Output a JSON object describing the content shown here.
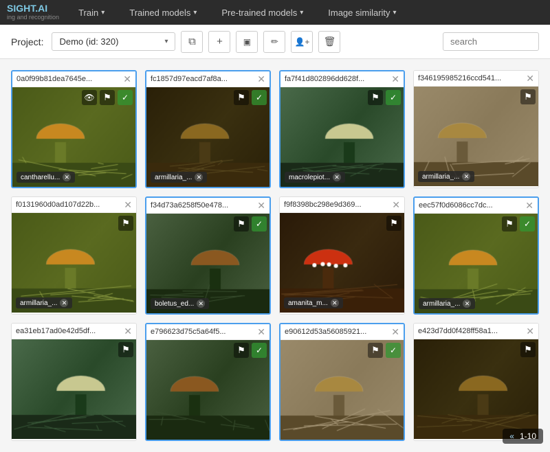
{
  "logo": {
    "name": "SIGHT.AI",
    "sub": "ing and recognition"
  },
  "nav": {
    "items": [
      {
        "label": "Train",
        "id": "train",
        "has_caret": true
      },
      {
        "label": "Trained models",
        "id": "trained-models",
        "has_caret": true
      },
      {
        "label": "Pre-trained models",
        "id": "pretrained-models",
        "has_caret": true
      },
      {
        "label": "Image similarity",
        "id": "image-similarity",
        "has_caret": true
      }
    ]
  },
  "project_bar": {
    "label": "Project:",
    "project_name": "Demo (id: 320)",
    "search_placeholder": "search",
    "toolbar_icons": [
      {
        "id": "copy",
        "symbol": "⧉",
        "name": "copy-button"
      },
      {
        "id": "add",
        "symbol": "+",
        "name": "add-button"
      },
      {
        "id": "layers",
        "symbol": "⬛",
        "name": "layers-button"
      },
      {
        "id": "edit",
        "symbol": "✏",
        "name": "edit-button"
      },
      {
        "id": "user-add",
        "symbol": "👤",
        "name": "user-add-button"
      },
      {
        "id": "delete",
        "symbol": "🗑",
        "name": "delete-button"
      }
    ]
  },
  "images": [
    {
      "id": "img1",
      "filename": "0a0f99b81dea7645e...",
      "label": "cantharellu...",
      "bg_class": "bg-chanterelle",
      "has_check": true,
      "has_eye": true,
      "border": "blue"
    },
    {
      "id": "img2",
      "filename": "fc1857d97eacd7af8a...",
      "label": "armillaria_...",
      "bg_class": "bg-armillaria",
      "has_check": true,
      "has_eye": false,
      "border": "blue"
    },
    {
      "id": "img3",
      "filename": "fa7f41d802896dd628f...",
      "label": "macrolepiot...",
      "bg_class": "bg-macrolepiota",
      "has_check": true,
      "has_eye": false,
      "border": "blue"
    },
    {
      "id": "img4",
      "filename": "f346195985216ccd541...",
      "label": "armillaria_...",
      "bg_class": "bg-tan",
      "has_check": false,
      "has_eye": false,
      "border": "normal"
    },
    {
      "id": "img5",
      "filename": "f0131960d0ad107d22b...",
      "label": "armillaria_...",
      "bg_class": "bg-chanterelle",
      "has_check": false,
      "has_eye": false,
      "border": "normal"
    },
    {
      "id": "img6",
      "filename": "f34d73a6258f50e478...",
      "label": "boletus_ed...",
      "bg_class": "bg-porcini",
      "has_check": true,
      "has_eye": false,
      "border": "blue"
    },
    {
      "id": "img7",
      "filename": "f9f8398bc298e9d369...",
      "label": "amanita_m...",
      "bg_class": "bg-amanita",
      "has_check": false,
      "has_eye": false,
      "border": "normal"
    },
    {
      "id": "img8",
      "filename": "eec57f0d6086cc7dc...",
      "label": "armillaria_...",
      "bg_class": "bg-chanterelle",
      "has_check": true,
      "has_eye": false,
      "border": "blue"
    },
    {
      "id": "img9",
      "filename": "ea31eb17ad0e42d5df...",
      "label": "",
      "bg_class": "bg-macrolepiota",
      "has_check": false,
      "has_eye": false,
      "border": "normal"
    },
    {
      "id": "img10",
      "filename": "e796623d75c5a64f5...",
      "label": "",
      "bg_class": "bg-porcini",
      "has_check": true,
      "has_eye": false,
      "border": "blue"
    },
    {
      "id": "img11",
      "filename": "e90612d53a56085921...",
      "label": "",
      "bg_class": "bg-tan",
      "has_check": true,
      "has_eye": false,
      "border": "blue"
    },
    {
      "id": "img12",
      "filename": "e423d7dd0f428ff58a1...",
      "label": "",
      "bg_class": "bg-armillaria",
      "has_check": false,
      "has_eye": false,
      "border": "normal"
    }
  ],
  "pagination": {
    "prev_icon": "«",
    "range": "1-10"
  }
}
